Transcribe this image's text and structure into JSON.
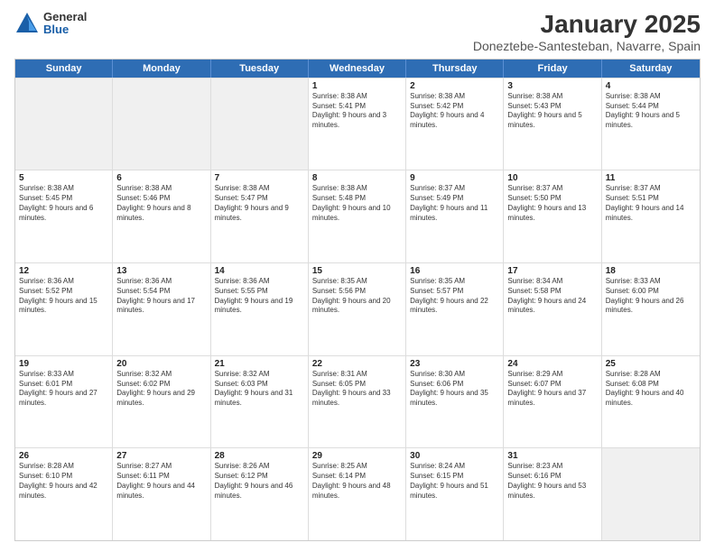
{
  "logo": {
    "general": "General",
    "blue": "Blue"
  },
  "title": "January 2025",
  "subtitle": "Doneztebe-Santesteban, Navarre, Spain",
  "days": [
    "Sunday",
    "Monday",
    "Tuesday",
    "Wednesday",
    "Thursday",
    "Friday",
    "Saturday"
  ],
  "weeks": [
    [
      {
        "day": "",
        "text": ""
      },
      {
        "day": "",
        "text": ""
      },
      {
        "day": "",
        "text": ""
      },
      {
        "day": "1",
        "text": "Sunrise: 8:38 AM\nSunset: 5:41 PM\nDaylight: 9 hours and 3 minutes."
      },
      {
        "day": "2",
        "text": "Sunrise: 8:38 AM\nSunset: 5:42 PM\nDaylight: 9 hours and 4 minutes."
      },
      {
        "day": "3",
        "text": "Sunrise: 8:38 AM\nSunset: 5:43 PM\nDaylight: 9 hours and 5 minutes."
      },
      {
        "day": "4",
        "text": "Sunrise: 8:38 AM\nSunset: 5:44 PM\nDaylight: 9 hours and 5 minutes."
      }
    ],
    [
      {
        "day": "5",
        "text": "Sunrise: 8:38 AM\nSunset: 5:45 PM\nDaylight: 9 hours and 6 minutes."
      },
      {
        "day": "6",
        "text": "Sunrise: 8:38 AM\nSunset: 5:46 PM\nDaylight: 9 hours and 8 minutes."
      },
      {
        "day": "7",
        "text": "Sunrise: 8:38 AM\nSunset: 5:47 PM\nDaylight: 9 hours and 9 minutes."
      },
      {
        "day": "8",
        "text": "Sunrise: 8:38 AM\nSunset: 5:48 PM\nDaylight: 9 hours and 10 minutes."
      },
      {
        "day": "9",
        "text": "Sunrise: 8:37 AM\nSunset: 5:49 PM\nDaylight: 9 hours and 11 minutes."
      },
      {
        "day": "10",
        "text": "Sunrise: 8:37 AM\nSunset: 5:50 PM\nDaylight: 9 hours and 13 minutes."
      },
      {
        "day": "11",
        "text": "Sunrise: 8:37 AM\nSunset: 5:51 PM\nDaylight: 9 hours and 14 minutes."
      }
    ],
    [
      {
        "day": "12",
        "text": "Sunrise: 8:36 AM\nSunset: 5:52 PM\nDaylight: 9 hours and 15 minutes."
      },
      {
        "day": "13",
        "text": "Sunrise: 8:36 AM\nSunset: 5:54 PM\nDaylight: 9 hours and 17 minutes."
      },
      {
        "day": "14",
        "text": "Sunrise: 8:36 AM\nSunset: 5:55 PM\nDaylight: 9 hours and 19 minutes."
      },
      {
        "day": "15",
        "text": "Sunrise: 8:35 AM\nSunset: 5:56 PM\nDaylight: 9 hours and 20 minutes."
      },
      {
        "day": "16",
        "text": "Sunrise: 8:35 AM\nSunset: 5:57 PM\nDaylight: 9 hours and 22 minutes."
      },
      {
        "day": "17",
        "text": "Sunrise: 8:34 AM\nSunset: 5:58 PM\nDaylight: 9 hours and 24 minutes."
      },
      {
        "day": "18",
        "text": "Sunrise: 8:33 AM\nSunset: 6:00 PM\nDaylight: 9 hours and 26 minutes."
      }
    ],
    [
      {
        "day": "19",
        "text": "Sunrise: 8:33 AM\nSunset: 6:01 PM\nDaylight: 9 hours and 27 minutes."
      },
      {
        "day": "20",
        "text": "Sunrise: 8:32 AM\nSunset: 6:02 PM\nDaylight: 9 hours and 29 minutes."
      },
      {
        "day": "21",
        "text": "Sunrise: 8:32 AM\nSunset: 6:03 PM\nDaylight: 9 hours and 31 minutes."
      },
      {
        "day": "22",
        "text": "Sunrise: 8:31 AM\nSunset: 6:05 PM\nDaylight: 9 hours and 33 minutes."
      },
      {
        "day": "23",
        "text": "Sunrise: 8:30 AM\nSunset: 6:06 PM\nDaylight: 9 hours and 35 minutes."
      },
      {
        "day": "24",
        "text": "Sunrise: 8:29 AM\nSunset: 6:07 PM\nDaylight: 9 hours and 37 minutes."
      },
      {
        "day": "25",
        "text": "Sunrise: 8:28 AM\nSunset: 6:08 PM\nDaylight: 9 hours and 40 minutes."
      }
    ],
    [
      {
        "day": "26",
        "text": "Sunrise: 8:28 AM\nSunset: 6:10 PM\nDaylight: 9 hours and 42 minutes."
      },
      {
        "day": "27",
        "text": "Sunrise: 8:27 AM\nSunset: 6:11 PM\nDaylight: 9 hours and 44 minutes."
      },
      {
        "day": "28",
        "text": "Sunrise: 8:26 AM\nSunset: 6:12 PM\nDaylight: 9 hours and 46 minutes."
      },
      {
        "day": "29",
        "text": "Sunrise: 8:25 AM\nSunset: 6:14 PM\nDaylight: 9 hours and 48 minutes."
      },
      {
        "day": "30",
        "text": "Sunrise: 8:24 AM\nSunset: 6:15 PM\nDaylight: 9 hours and 51 minutes."
      },
      {
        "day": "31",
        "text": "Sunrise: 8:23 AM\nSunset: 6:16 PM\nDaylight: 9 hours and 53 minutes."
      },
      {
        "day": "",
        "text": ""
      }
    ]
  ]
}
